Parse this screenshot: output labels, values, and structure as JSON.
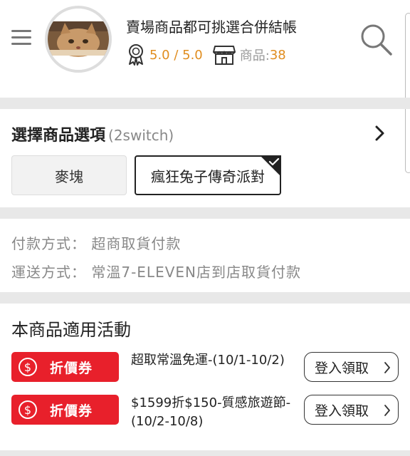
{
  "store": {
    "name": "賣場商品都可挑選合併結帳",
    "rating": "5.0 / 5.0",
    "goods_label": "商品:",
    "goods_count": "38"
  },
  "options": {
    "title": "選擇商品選項",
    "subtitle": "(2switch)",
    "items": [
      {
        "label": "麥塊",
        "selected": false
      },
      {
        "label": "瘋狂兔子傳奇派對",
        "selected": true
      }
    ]
  },
  "payment": {
    "method": "付款方式： 超商取貨付款",
    "shipping": "運送方式： 常溫7-ELEVEN店到店取貨付款"
  },
  "activities": {
    "title": "本商品適用活動",
    "items": [
      {
        "badge": "折價券",
        "text": "超取常溫免運-(10/1-10/2)",
        "button": "登入領取"
      },
      {
        "badge": "折價券",
        "text": "$1599折$150-質感旅遊節-(10/2-10/8)",
        "button": "登入領取"
      }
    ]
  },
  "colors": {
    "accent_orange": "#e08d1f",
    "coupon_red": "#e8202b"
  },
  "icons": [
    "menu-icon",
    "cat-avatar",
    "award-icon",
    "shop-icon",
    "search-icon",
    "chevron-right-icon",
    "check-icon",
    "dollar-circle-icon"
  ]
}
